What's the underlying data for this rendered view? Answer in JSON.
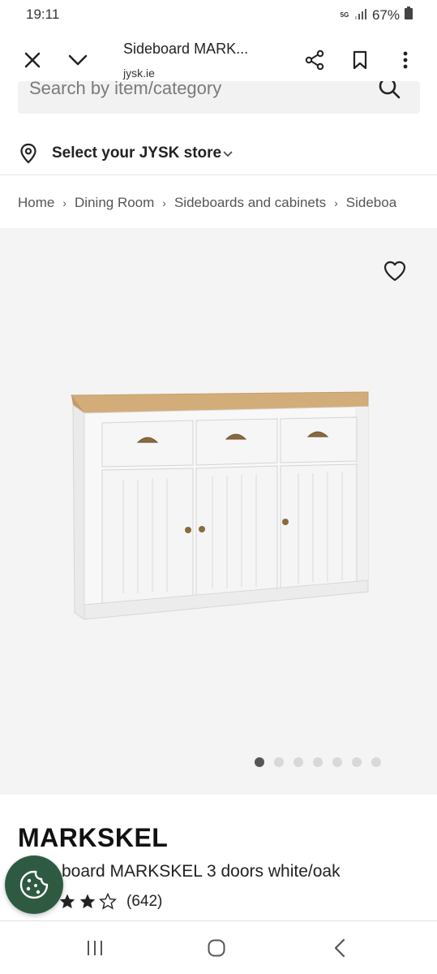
{
  "status_bar": {
    "time": "19:11",
    "network": "5G",
    "battery": "67%"
  },
  "browser": {
    "title": "Sideboard MARK...",
    "domain": "jysk.ie",
    "icons": [
      "close-icon",
      "chevron-down-icon",
      "share-icon",
      "bookmark-icon",
      "more-vertical-icon"
    ]
  },
  "search": {
    "placeholder": "Search by item/category"
  },
  "store": {
    "label": "Select your JYSK store"
  },
  "breadcrumb": {
    "items": [
      "Home",
      "Dining Room",
      "Sideboards and cabinets",
      "Sideboa"
    ]
  },
  "gallery": {
    "image_alt": "Sideboard MARKSKEL 3 doors white/oak",
    "dots_total": 7,
    "dots_active_index": 0
  },
  "product": {
    "name": "MARKSKEL",
    "description": "board MARKSKEL 3 doors white/oak",
    "rating": {
      "stars": 3.5,
      "max": 5,
      "count_label": "(642)"
    }
  },
  "colors": {
    "accent_green": "#2f5a42",
    "gallery_bg": "#f4f4f4",
    "oak": "#d2ad7a"
  },
  "nav_bar": {
    "icons": [
      "recent-apps-icon",
      "home-icon",
      "back-icon"
    ]
  }
}
